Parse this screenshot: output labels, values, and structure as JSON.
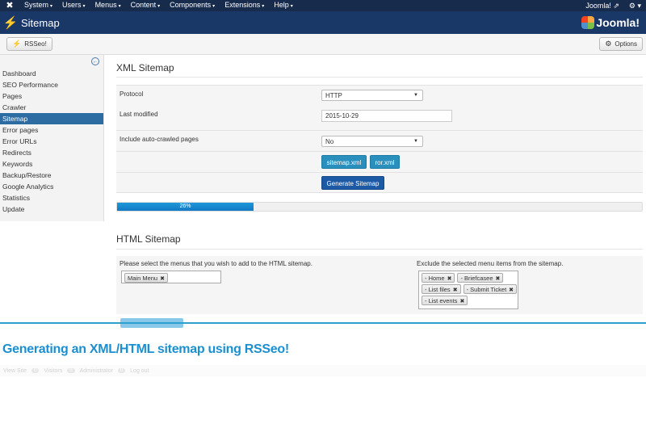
{
  "topnav": {
    "menus": [
      "System",
      "Users",
      "Menus",
      "Content",
      "Components",
      "Extensions",
      "Help"
    ],
    "site_link": "Joomla! ⇗",
    "gear": "⚙ ▾"
  },
  "header": {
    "title": "Sitemap",
    "logo": "Joomla!"
  },
  "toolbar": {
    "rsseo_label": "RSSeo!",
    "options_label": "Options"
  },
  "sidebar": {
    "items": [
      {
        "label": "Dashboard"
      },
      {
        "label": "SEO Performance"
      },
      {
        "label": "Pages"
      },
      {
        "label": "Crawler"
      },
      {
        "label": "Sitemap",
        "active": true
      },
      {
        "label": "Error pages"
      },
      {
        "label": "Error URLs"
      },
      {
        "label": "Redirects"
      },
      {
        "label": "Keywords"
      },
      {
        "label": "Backup/Restore"
      },
      {
        "label": "Google Analytics"
      },
      {
        "label": "Statistics"
      },
      {
        "label": "Update"
      }
    ]
  },
  "xml": {
    "heading": "XML Sitemap",
    "protocol_label": "Protocol",
    "protocol_value": "HTTP",
    "last_modified_label": "Last modified",
    "last_modified_value": "2015-10-29",
    "autocrawl_label": "Include auto-crawled pages",
    "autocrawl_value": "No",
    "btn_sitemap": "sitemap.xml",
    "btn_ror": "ror.xml",
    "btn_generate": "Generate Sitemap",
    "progress_text": "26%",
    "progress_value": 0.26
  },
  "html": {
    "heading": "HTML Sitemap",
    "menus_label": "Please select the menus that you wish to add to the HTML sitemap.",
    "menus_selected": [
      "Main Menu"
    ],
    "exclude_label": "Exclude the selected menu items from the sitemap.",
    "exclude_selected": [
      "- Home",
      "- Briefcasee",
      "- List files",
      "- Submit Ticket",
      "- List events"
    ]
  },
  "caption": "Generating an XML/HTML sitemap using RSSeo!",
  "statusbar": {
    "view_site": "View Site",
    "visitors": "Visitors",
    "administrator": "Administrator",
    "logout": "Log out",
    "count": "0"
  },
  "colors": {
    "topnav": "#172b4d",
    "header": "#1a3867",
    "accent": "#1b8fcf",
    "active_item": "#2d6ca2"
  }
}
